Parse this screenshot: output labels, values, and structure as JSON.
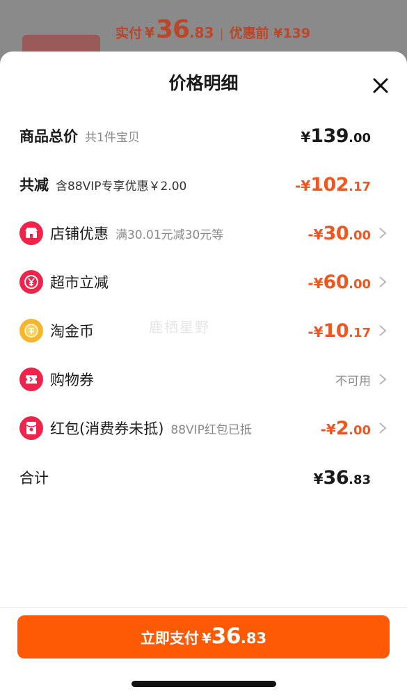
{
  "background_order": {
    "paid_label": "实付",
    "currency": "¥",
    "paid_int": "36",
    "paid_dec": ".83",
    "separator": "|",
    "original_label": "优惠前 ¥139"
  },
  "sheet": {
    "title": "价格明细",
    "rows": [
      {
        "label": "商品总价",
        "sub": "共1件宝贝",
        "currency": "¥",
        "int": "139",
        "dec": ".00"
      },
      {
        "label": "共减",
        "sub": "含88VIP专享优惠￥2.00",
        "currency": "-¥",
        "int": "102",
        "dec": ".17"
      },
      {
        "label": "店铺优惠",
        "sub": "满30.01元减30元等",
        "currency": "-¥",
        "int": "30",
        "dec": ".00",
        "icon": "store-icon",
        "icon_color": "#f0244a"
      },
      {
        "label": "超市立减",
        "sub": "",
        "currency": "-¥",
        "int": "60",
        "dec": ".00",
        "icon": "yuan-icon",
        "icon_color": "#f0244a"
      },
      {
        "label": "淘金币",
        "sub": "",
        "currency": "-¥",
        "int": "10",
        "dec": ".17",
        "icon": "gold-coin-icon",
        "icon_color": "#f7b52c"
      },
      {
        "label": "购物券",
        "sub": "",
        "status": "不可用",
        "icon": "coupon-icon",
        "icon_color": "#f0244a"
      },
      {
        "label": "红包(消费券未抵)",
        "sub": "88VIP红包已抵",
        "currency": "-¥",
        "int": "2",
        "dec": ".00",
        "icon": "red-packet-icon",
        "icon_color": "#f0244a"
      },
      {
        "label": "合计",
        "sub": "",
        "currency": "¥",
        "int": "36",
        "dec": ".83"
      }
    ],
    "watermark": "鹿栖星野"
  },
  "pay_button": {
    "label": "立即支付",
    "currency": "¥",
    "int": "36",
    "dec": ".83"
  },
  "colors": {
    "accent": "#fe5a06",
    "discount_red": "#f0561e",
    "icon_red": "#f0244a",
    "coin_gold": "#f7b52c"
  }
}
